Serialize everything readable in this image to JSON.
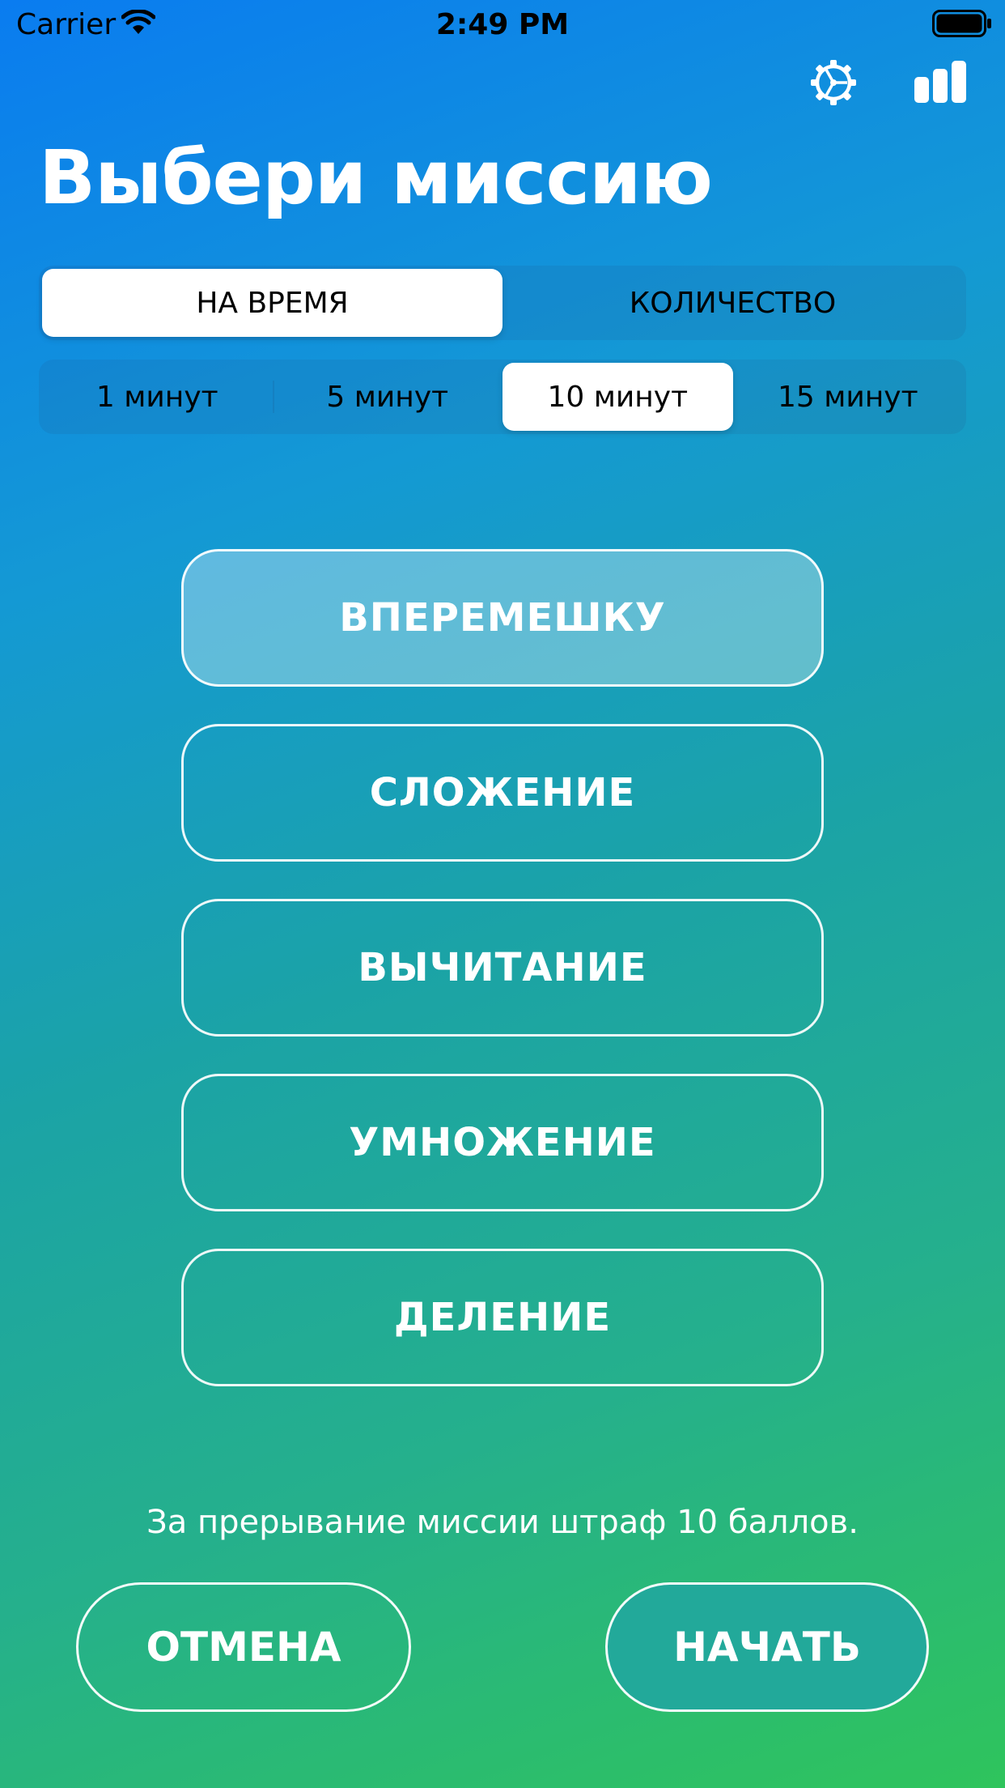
{
  "status_bar": {
    "carrier": "Carrier",
    "time": "2:49 PM"
  },
  "toolbar": {
    "settings_icon": "gear-icon",
    "stats_icon": "bar-chart-icon"
  },
  "title": "Выбери миссию",
  "mode_selector": {
    "options": [
      "НА ВРЕМЯ",
      "КОЛИЧЕСТВО"
    ],
    "selected": "НА ВРЕМЯ"
  },
  "time_selector": {
    "options": [
      "1 минут",
      "5 минут",
      "10 минут",
      "15 минут"
    ],
    "selected": "10 минут"
  },
  "missions": {
    "items": [
      "ВПЕРЕМЕШКУ",
      "СЛОЖЕНИЕ",
      "ВЫЧИТАНИЕ",
      "УМНОЖЕНИЕ",
      "ДЕЛЕНИЕ"
    ],
    "selected": "ВПЕРЕМЕШКУ"
  },
  "penalty_note": "За прерывание миссии штраф 10 баллов.",
  "actions": {
    "cancel_label": "ОТМЕНА",
    "start_label": "НАЧАТЬ"
  },
  "colors": {
    "gradient_top": "#0a7cf0",
    "gradient_bottom": "#2fc45c",
    "start_button_fill": "#22a99a"
  }
}
